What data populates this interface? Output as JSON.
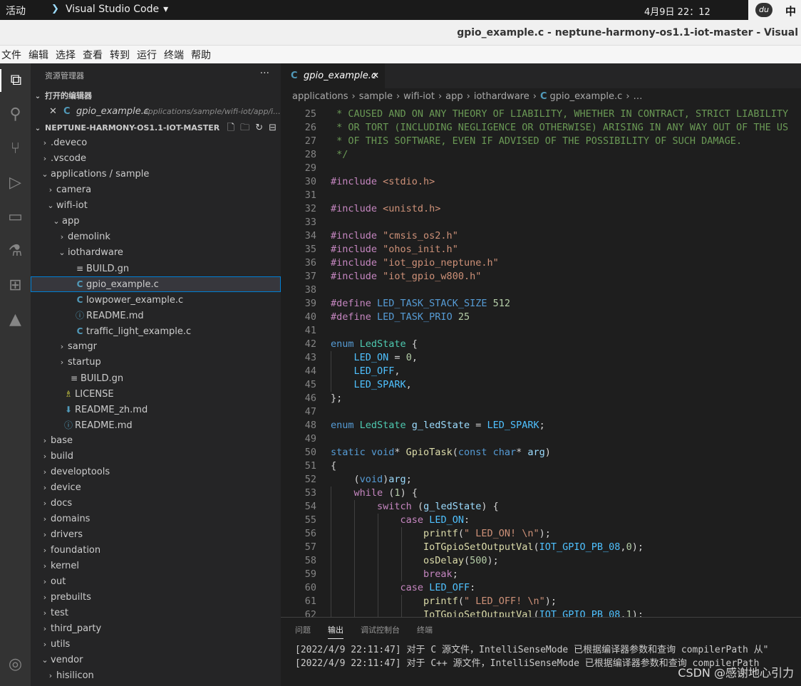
{
  "topbar": {
    "activities": "活动",
    "app_name": "Visual Studio Code",
    "clock": "4月9日  22：12",
    "ime_logo": "du",
    "ime_label": "中"
  },
  "window": {
    "title": "gpio_example.c - neptune-harmony-os1.1-iot-master - Visual"
  },
  "menubar": [
    "文件",
    "编辑",
    "选择",
    "查看",
    "转到",
    "运行",
    "终端",
    "帮助"
  ],
  "sidebar": {
    "title": "资源管理器",
    "more": "···",
    "open_editors_label": "打开的编辑器",
    "open_file": {
      "close": "✕",
      "icon": "C",
      "name": "gpio_example.c",
      "path": "applications/sample/wifi-iot/app/i..."
    },
    "workspace_label": "NEPTUNE-HARMONY-OS1.1-IOT-MASTER",
    "tree": [
      {
        "label": ".deveco",
        "indent": 1,
        "chev": "›",
        "icon": ""
      },
      {
        "label": ".vscode",
        "indent": 1,
        "chev": "›",
        "icon": ""
      },
      {
        "label": "applications / sample",
        "indent": 1,
        "chev": "⌄",
        "icon": ""
      },
      {
        "label": "camera",
        "indent": 2,
        "chev": "›",
        "icon": ""
      },
      {
        "label": "wifi-iot",
        "indent": 2,
        "chev": "⌄",
        "icon": ""
      },
      {
        "label": "app",
        "indent": 3,
        "chev": "⌄",
        "icon": ""
      },
      {
        "label": "demolink",
        "indent": 4,
        "chev": "›",
        "icon": ""
      },
      {
        "label": "iothardware",
        "indent": 4,
        "chev": "⌄",
        "icon": ""
      },
      {
        "label": "BUILD.gn",
        "indent": 5,
        "chev": "",
        "icon": "≡"
      },
      {
        "label": "gpio_example.c",
        "indent": 5,
        "chev": "",
        "icon": "C",
        "selected": true
      },
      {
        "label": "lowpower_example.c",
        "indent": 5,
        "chev": "",
        "icon": "C"
      },
      {
        "label": "README.md",
        "indent": 5,
        "chev": "",
        "icon": "ⓘ"
      },
      {
        "label": "traffic_light_example.c",
        "indent": 5,
        "chev": "",
        "icon": "C"
      },
      {
        "label": "samgr",
        "indent": 4,
        "chev": "›",
        "icon": ""
      },
      {
        "label": "startup",
        "indent": 4,
        "chev": "›",
        "icon": ""
      },
      {
        "label": "BUILD.gn",
        "indent": 4,
        "chev": "",
        "icon": "≡"
      },
      {
        "label": "LICENSE",
        "indent": 3,
        "chev": "",
        "icon": "♗"
      },
      {
        "label": "README_zh.md",
        "indent": 3,
        "chev": "",
        "icon": "⬇"
      },
      {
        "label": "README.md",
        "indent": 3,
        "chev": "",
        "icon": "ⓘ"
      },
      {
        "label": "base",
        "indent": 1,
        "chev": "›",
        "icon": ""
      },
      {
        "label": "build",
        "indent": 1,
        "chev": "›",
        "icon": ""
      },
      {
        "label": "developtools",
        "indent": 1,
        "chev": "›",
        "icon": ""
      },
      {
        "label": "device",
        "indent": 1,
        "chev": "›",
        "icon": ""
      },
      {
        "label": "docs",
        "indent": 1,
        "chev": "›",
        "icon": ""
      },
      {
        "label": "domains",
        "indent": 1,
        "chev": "›",
        "icon": ""
      },
      {
        "label": "drivers",
        "indent": 1,
        "chev": "›",
        "icon": ""
      },
      {
        "label": "foundation",
        "indent": 1,
        "chev": "›",
        "icon": ""
      },
      {
        "label": "kernel",
        "indent": 1,
        "chev": "›",
        "icon": ""
      },
      {
        "label": "out",
        "indent": 1,
        "chev": "›",
        "icon": ""
      },
      {
        "label": "prebuilts",
        "indent": 1,
        "chev": "›",
        "icon": ""
      },
      {
        "label": "test",
        "indent": 1,
        "chev": "›",
        "icon": ""
      },
      {
        "label": "third_party",
        "indent": 1,
        "chev": "›",
        "icon": ""
      },
      {
        "label": "utils",
        "indent": 1,
        "chev": "›",
        "icon": ""
      },
      {
        "label": "vendor",
        "indent": 1,
        "chev": "⌄",
        "icon": ""
      },
      {
        "label": "hisilicon",
        "indent": 2,
        "chev": "›",
        "icon": ""
      }
    ]
  },
  "editor": {
    "tab": {
      "icon": "C",
      "name": "gpio_example.c",
      "close": "✕"
    },
    "breadcrumb": [
      "applications",
      "sample",
      "wifi-iot",
      "app",
      "iothardware",
      "gpio_example.c",
      "…"
    ],
    "breadcrumb_sep": "›",
    "breadcrumb_file_icon": "C",
    "lines": [
      {
        "n": "25",
        "t": [
          [
            "cm",
            " * CAUSED AND ON ANY THEORY OF LIABILITY, WHETHER IN CONTRACT, STRICT LIABILITY"
          ]
        ]
      },
      {
        "n": "26",
        "t": [
          [
            "cm",
            " * OR TORT (INCLUDING NEGLIGENCE OR OTHERWISE) ARISING IN ANY WAY OUT OF THE US"
          ]
        ]
      },
      {
        "n": "27",
        "t": [
          [
            "cm",
            " * OF THIS SOFTWARE, EVEN IF ADVISED OF THE POSSIBILITY OF SUCH DAMAGE."
          ]
        ]
      },
      {
        "n": "28",
        "t": [
          [
            "cm",
            " */"
          ]
        ]
      },
      {
        "n": "29",
        "t": []
      },
      {
        "n": "30",
        "t": [
          [
            "kw",
            "#include "
          ],
          [
            "st",
            "<stdio.h>"
          ]
        ]
      },
      {
        "n": "31",
        "t": []
      },
      {
        "n": "32",
        "t": [
          [
            "kw",
            "#include "
          ],
          [
            "st",
            "<unistd.h>"
          ]
        ]
      },
      {
        "n": "33",
        "t": []
      },
      {
        "n": "34",
        "t": [
          [
            "kw",
            "#include "
          ],
          [
            "st",
            "\"cmsis_os2.h\""
          ]
        ]
      },
      {
        "n": "35",
        "t": [
          [
            "kw",
            "#include "
          ],
          [
            "st",
            "\"ohos_init.h\""
          ]
        ]
      },
      {
        "n": "36",
        "t": [
          [
            "kw",
            "#include "
          ],
          [
            "st",
            "\"iot_gpio_neptune.h\""
          ]
        ]
      },
      {
        "n": "37",
        "t": [
          [
            "kw",
            "#include "
          ],
          [
            "st",
            "\"iot_gpio_w800.h\""
          ]
        ]
      },
      {
        "n": "38",
        "t": []
      },
      {
        "n": "39",
        "t": [
          [
            "kw",
            "#define "
          ],
          [
            "ty",
            "LED_TASK_STACK_SIZE "
          ],
          [
            "nu",
            "512"
          ]
        ]
      },
      {
        "n": "40",
        "t": [
          [
            "kw",
            "#define "
          ],
          [
            "ty",
            "LED_TASK_PRIO "
          ],
          [
            "nu",
            "25"
          ]
        ]
      },
      {
        "n": "41",
        "t": []
      },
      {
        "n": "42",
        "t": [
          [
            "ty",
            "enum "
          ],
          [
            "cl",
            "LedState "
          ],
          [
            "pl",
            "{"
          ]
        ]
      },
      {
        "n": "43",
        "t": [
          [
            "pl",
            "    "
          ],
          [
            "en",
            "LED_ON"
          ],
          [
            "pl",
            " = "
          ],
          [
            "nu",
            "0"
          ],
          [
            "pl",
            ","
          ]
        ]
      },
      {
        "n": "44",
        "t": [
          [
            "pl",
            "    "
          ],
          [
            "en",
            "LED_OFF"
          ],
          [
            "pl",
            ","
          ]
        ]
      },
      {
        "n": "45",
        "t": [
          [
            "pl",
            "    "
          ],
          [
            "en",
            "LED_SPARK"
          ],
          [
            "pl",
            ","
          ]
        ]
      },
      {
        "n": "46",
        "t": [
          [
            "pl",
            "};"
          ]
        ]
      },
      {
        "n": "47",
        "t": []
      },
      {
        "n": "48",
        "t": [
          [
            "ty",
            "enum "
          ],
          [
            "cl",
            "LedState "
          ],
          [
            "va",
            "g_ledState"
          ],
          [
            "pl",
            " = "
          ],
          [
            "en",
            "LED_SPARK"
          ],
          [
            "pl",
            ";"
          ]
        ]
      },
      {
        "n": "49",
        "t": []
      },
      {
        "n": "50",
        "t": [
          [
            "ty",
            "static void"
          ],
          [
            "pl",
            "* "
          ],
          [
            "fn",
            "GpioTask"
          ],
          [
            "pl",
            "("
          ],
          [
            "ty",
            "const char"
          ],
          [
            "pl",
            "* "
          ],
          [
            "va",
            "arg"
          ],
          [
            "pl",
            ")"
          ]
        ]
      },
      {
        "n": "51",
        "t": [
          [
            "pl",
            "{"
          ]
        ]
      },
      {
        "n": "52",
        "t": [
          [
            "pl",
            "    ("
          ],
          [
            "ty",
            "void"
          ],
          [
            "pl",
            ")"
          ],
          [
            "va",
            "arg"
          ],
          [
            "pl",
            ";"
          ]
        ]
      },
      {
        "n": "53",
        "t": [
          [
            "pl",
            "    "
          ],
          [
            "kw",
            "while"
          ],
          [
            "pl",
            " ("
          ],
          [
            "nu",
            "1"
          ],
          [
            "pl",
            ") {"
          ]
        ]
      },
      {
        "n": "54",
        "t": [
          [
            "pl",
            "        "
          ],
          [
            "kw",
            "switch"
          ],
          [
            "pl",
            " ("
          ],
          [
            "va",
            "g_ledState"
          ],
          [
            "pl",
            ") {"
          ]
        ]
      },
      {
        "n": "55",
        "t": [
          [
            "pl",
            "            "
          ],
          [
            "kw",
            "case "
          ],
          [
            "en",
            "LED_ON"
          ],
          [
            "pl",
            ":"
          ]
        ]
      },
      {
        "n": "56",
        "t": [
          [
            "pl",
            "                "
          ],
          [
            "fn",
            "printf"
          ],
          [
            "pl",
            "("
          ],
          [
            "st",
            "\" LED_ON! \\n\""
          ],
          [
            "pl",
            ");"
          ]
        ]
      },
      {
        "n": "57",
        "t": [
          [
            "pl",
            "                "
          ],
          [
            "fn",
            "IoTGpioSetOutputVal"
          ],
          [
            "pl",
            "("
          ],
          [
            "en",
            "IOT_GPIO_PB_08"
          ],
          [
            "pl",
            ","
          ],
          [
            "nu",
            "0"
          ],
          [
            "pl",
            ");"
          ]
        ]
      },
      {
        "n": "58",
        "t": [
          [
            "pl",
            "                "
          ],
          [
            "fn",
            "osDelay"
          ],
          [
            "pl",
            "("
          ],
          [
            "nu",
            "500"
          ],
          [
            "pl",
            ");"
          ]
        ]
      },
      {
        "n": "59",
        "t": [
          [
            "pl",
            "                "
          ],
          [
            "kw",
            "break"
          ],
          [
            "pl",
            ";"
          ]
        ]
      },
      {
        "n": "60",
        "t": [
          [
            "pl",
            "            "
          ],
          [
            "kw",
            "case "
          ],
          [
            "en",
            "LED_OFF"
          ],
          [
            "pl",
            ":"
          ]
        ]
      },
      {
        "n": "61",
        "t": [
          [
            "pl",
            "                "
          ],
          [
            "fn",
            "printf"
          ],
          [
            "pl",
            "("
          ],
          [
            "st",
            "\" LED_OFF! \\n\""
          ],
          [
            "pl",
            ");"
          ]
        ]
      },
      {
        "n": "62",
        "t": [
          [
            "pl",
            "                "
          ],
          [
            "fn",
            "IoTGpioSetOutputVal"
          ],
          [
            "pl",
            "("
          ],
          [
            "en",
            "IOT_GPIO_PB_08"
          ],
          [
            "pl",
            ","
          ],
          [
            "nu",
            "1"
          ],
          [
            "pl",
            ");"
          ]
        ]
      }
    ]
  },
  "panel": {
    "tabs": [
      "问题",
      "输出",
      "调试控制台",
      "终端"
    ],
    "active_tab": 1,
    "lines": [
      "[2022/4/9 22:11:47] 对于 C 源文件，IntelliSenseMode 已根据编译器参数和查询 compilerPath 从\"",
      "[2022/4/9 22:11:47] 对于 C++ 源文件，IntelliSenseMode 已根据编译器参数和查询 compilerPath"
    ],
    "watermark": "CSDN @感谢地心引力"
  },
  "colors": {
    "accent": "#007fd4",
    "c_icon": "#519aba",
    "background": "#1e1e1e"
  }
}
